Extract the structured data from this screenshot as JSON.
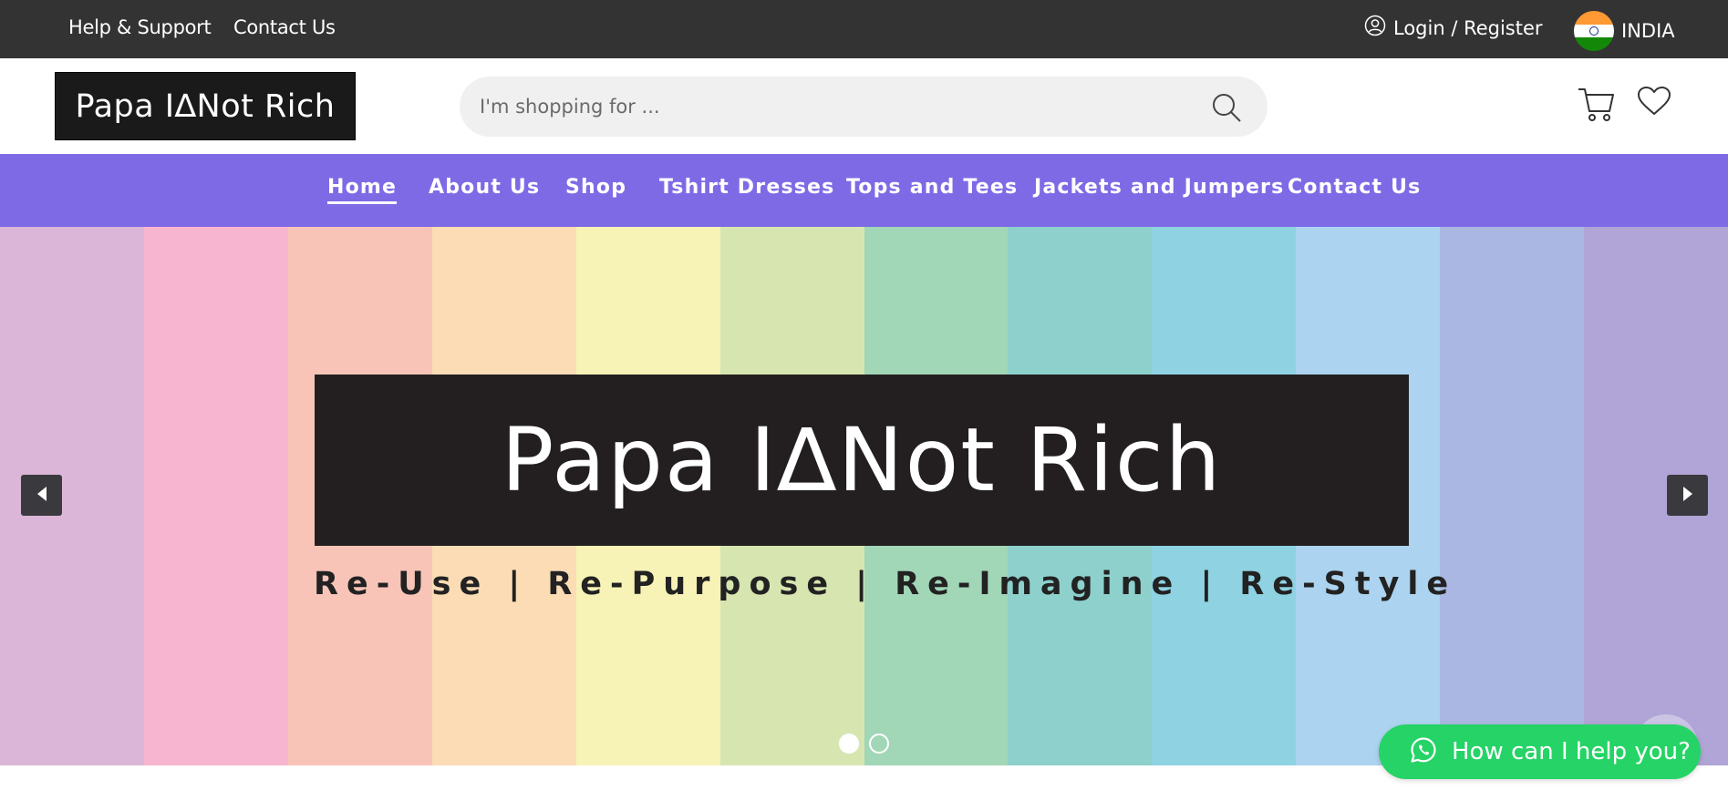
{
  "topbar": {
    "links": [
      "Help & Support",
      "Contact Us"
    ],
    "login_label": "Login / Register",
    "country": "INDIA"
  },
  "header": {
    "logo_text": "Papa I∆Not Rich",
    "search_placeholder": "I'm shopping for ...",
    "icons": [
      "cart-icon",
      "wishlist-heart-icon",
      "search-icon",
      "user-icon"
    ]
  },
  "nav": {
    "items": [
      "Home",
      "About Us",
      "Shop",
      "Tshirt Dresses",
      "Tops and Tees",
      "Jackets and Jumpers",
      "Contact Us"
    ],
    "active": "Home",
    "background": "#7f6ae6"
  },
  "hero": {
    "banner_text": "Papa I∆Not Rich",
    "tagline": "Re-Use | Re-Purpose | Re-Imagine | Re-Style",
    "stripe_colors": [
      "#dcb6d8",
      "#f7b5d0",
      "#f8c4b8",
      "#fbdcb5",
      "#f7f3b6",
      "#d7e6b0",
      "#a1d6b6",
      "#8dd0cc",
      "#8fd3e2",
      "#acd3ef",
      "#aab7e2",
      "#b0a5d6"
    ],
    "slides_total": 2,
    "active_slide": 1
  },
  "whatsapp": {
    "label": "How can I help you?",
    "color": "#25d366"
  }
}
